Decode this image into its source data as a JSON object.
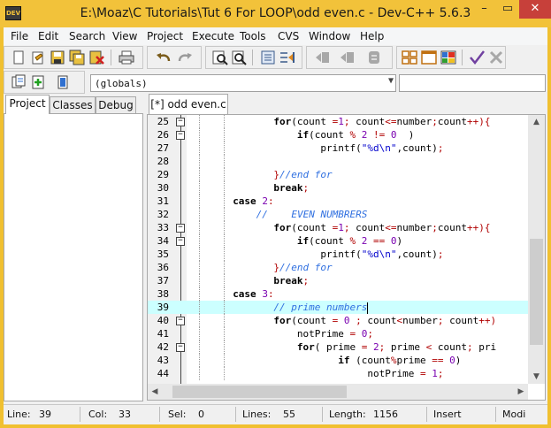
{
  "window": {
    "title": "E:\\Moaz\\C Tutorials\\Tut 6 For LOOP\\odd even.c - Dev-C++ 5.6.3",
    "app_icon": "DEV",
    "min_glyph": "–",
    "max_glyph": "▭",
    "close_glyph": "✕"
  },
  "menu": [
    "File",
    "Edit",
    "Search",
    "View",
    "Project",
    "Execute",
    "Tools",
    "CVS",
    "Window",
    "Help"
  ],
  "toolbar": {
    "icons": [
      "new-file-icon",
      "open-icon",
      "save-icon",
      "save-all-icon",
      "close-file-icon",
      "print-icon",
      "undo-icon",
      "redo-icon",
      "find-icon",
      "replace-icon",
      "indent-icon",
      "unindent-icon",
      "goto-icon",
      "bookmark-icon",
      "toggle-icon",
      "tile-icon",
      "window-icon",
      "chart-icon",
      "check-icon",
      "stop-icon"
    ],
    "scope_combo": "(globals)",
    "combo_arrow": "▼"
  },
  "left_tabs": [
    "Project",
    "Classes",
    "Debug"
  ],
  "editor_tab": "[*] odd even.c",
  "code_lines": [
    {
      "n": "25",
      "fold": "−",
      "parts": [
        [
          "kw",
          "for"
        ],
        [
          "",
          "(count "
        ],
        [
          "sym",
          "="
        ],
        [
          "num",
          "1"
        ],
        [
          "sym",
          ";"
        ],
        [
          "",
          " count"
        ],
        [
          "sym",
          "<="
        ],
        [
          "",
          "number"
        ],
        [
          "sym",
          ";"
        ],
        [
          "",
          "count"
        ],
        [
          "sym",
          "++){"
        ]
      ]
    },
    {
      "n": "26",
      "fold": "−",
      "parts": [
        [
          "",
          ""
        ],
        [
          "kw",
          "    if"
        ],
        [
          "",
          "(count "
        ],
        [
          "sym",
          "%"
        ],
        [
          "num",
          " 2 "
        ],
        [
          "sym",
          "!="
        ],
        [
          "num",
          " 0"
        ],
        [
          "",
          "  )"
        ]
      ]
    },
    {
      "n": "27",
      "fold": "",
      "parts": [
        [
          "",
          "        printf("
        ],
        [
          "str",
          "\"%d\\n\""
        ],
        [
          "",
          ",count)"
        ],
        [
          "sym",
          ";"
        ]
      ]
    },
    {
      "n": "28",
      "fold": "",
      "parts": []
    },
    {
      "n": "29",
      "fold": "",
      "parts": [
        [
          "sym",
          "}"
        ],
        [
          "cm",
          "//end for"
        ]
      ]
    },
    {
      "n": "30",
      "fold": "",
      "parts": [
        [
          "kw",
          "break"
        ],
        [
          "sym",
          ";"
        ]
      ]
    },
    {
      "n": "31",
      "fold": "",
      "parts": [
        [
          "kw",
          "case "
        ],
        [
          "num",
          "2"
        ],
        [
          "sym",
          ":"
        ]
      ]
    },
    {
      "n": "32",
      "fold": "",
      "parts": [
        [
          "cm",
          "//    EVEN NUMBRERS"
        ]
      ]
    },
    {
      "n": "33",
      "fold": "−",
      "parts": [
        [
          "kw",
          "for"
        ],
        [
          "",
          "(count "
        ],
        [
          "sym",
          "="
        ],
        [
          "num",
          "1"
        ],
        [
          "sym",
          ";"
        ],
        [
          "",
          " count"
        ],
        [
          "sym",
          "<="
        ],
        [
          "",
          "number"
        ],
        [
          "sym",
          ";"
        ],
        [
          "",
          "count"
        ],
        [
          "sym",
          "++){"
        ]
      ]
    },
    {
      "n": "34",
      "fold": "−",
      "parts": [
        [
          "kw",
          "    if"
        ],
        [
          "",
          "(count "
        ],
        [
          "sym",
          "%"
        ],
        [
          "num",
          " 2 "
        ],
        [
          "sym",
          "=="
        ],
        [
          "num",
          " 0"
        ],
        [
          "",
          ")"
        ]
      ]
    },
    {
      "n": "35",
      "fold": "",
      "parts": [
        [
          "",
          "        printf("
        ],
        [
          "str",
          "\"%d\\n\""
        ],
        [
          "",
          ",count)"
        ],
        [
          "sym",
          ";"
        ]
      ]
    },
    {
      "n": "36",
      "fold": "",
      "parts": [
        [
          "sym",
          "}"
        ],
        [
          "cm",
          "//end for"
        ]
      ]
    },
    {
      "n": "37",
      "fold": "",
      "parts": [
        [
          "kw",
          "break"
        ],
        [
          "sym",
          ";"
        ]
      ]
    },
    {
      "n": "38",
      "fold": "",
      "parts": [
        [
          "kw",
          "case "
        ],
        [
          "num",
          "3"
        ],
        [
          "sym",
          ":"
        ]
      ]
    },
    {
      "n": "39",
      "fold": "",
      "parts": [
        [
          "cm",
          "// prime numbers"
        ]
      ]
    },
    {
      "n": "40",
      "fold": "−",
      "parts": [
        [
          "kw",
          "for"
        ],
        [
          "",
          "(count "
        ],
        [
          "sym",
          "="
        ],
        [
          "num",
          " 0"
        ],
        [
          "sym",
          " ;"
        ],
        [
          "",
          " count"
        ],
        [
          "sym",
          "<"
        ],
        [
          "",
          "number"
        ],
        [
          "sym",
          ";"
        ],
        [
          "",
          " count"
        ],
        [
          "sym",
          "++)"
        ]
      ]
    },
    {
      "n": "41",
      "fold": "",
      "parts": [
        [
          "",
          "    notPrime "
        ],
        [
          "sym",
          "="
        ],
        [
          "num",
          " 0"
        ],
        [
          "sym",
          ";"
        ]
      ]
    },
    {
      "n": "42",
      "fold": "−",
      "parts": [
        [
          "kw",
          "    for"
        ],
        [
          "",
          "( prime "
        ],
        [
          "sym",
          "="
        ],
        [
          "num",
          " 2"
        ],
        [
          "sym",
          ";"
        ],
        [
          "",
          " prime "
        ],
        [
          "sym",
          "<"
        ],
        [
          "",
          " count"
        ],
        [
          "sym",
          ";"
        ],
        [
          "",
          " pri"
        ]
      ]
    },
    {
      "n": "43",
      "fold": "",
      "parts": [
        [
          "kw",
          "           if"
        ],
        [
          "",
          " (count"
        ],
        [
          "sym",
          "%"
        ],
        [
          "",
          "prime "
        ],
        [
          "sym",
          "=="
        ],
        [
          "num",
          " 0"
        ],
        [
          "",
          ")"
        ]
      ]
    },
    {
      "n": "44",
      "fold": "",
      "parts": [
        [
          "",
          "                notPrime "
        ],
        [
          "sym",
          "="
        ],
        [
          "num",
          " 1"
        ],
        [
          "sym",
          ";"
        ]
      ]
    }
  ],
  "status": {
    "line_label": "Line:",
    "line_value": "39",
    "col_label": "Col:",
    "col_value": "33",
    "sel_label": "Sel:",
    "sel_value": "0",
    "lines_label": "Lines:",
    "lines_value": "55",
    "length_label": "Length:",
    "length_value": "1156",
    "mode": "Insert",
    "modified": "Modi"
  },
  "scroll": {
    "up": "▲",
    "down": "▼",
    "left": "◀",
    "right": "▶"
  },
  "colors": {
    "titlebar": "#f2c23a",
    "close": "#c7403a",
    "current_line": "#ccffff",
    "comment": "#2f6fe0",
    "number": "#7a00b0",
    "string": "#0000cc"
  }
}
